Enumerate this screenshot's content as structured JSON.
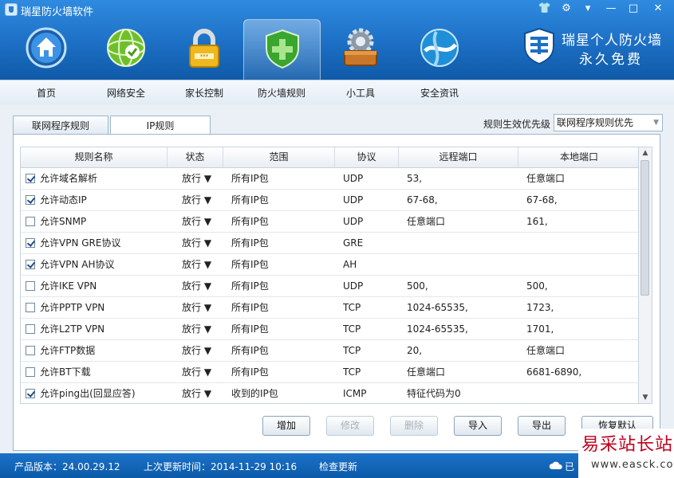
{
  "app": {
    "title": "瑞星防火墙软件"
  },
  "window_controls": {
    "shirt": "👕",
    "gear": "⚙",
    "menu": "▾",
    "minimize": "—",
    "maximize": "□",
    "close": "✕"
  },
  "nav": [
    {
      "label": "首页",
      "icon": "home-icon"
    },
    {
      "label": "网络安全",
      "icon": "globe-check-icon"
    },
    {
      "label": "家长控制",
      "icon": "padlock-icon"
    },
    {
      "label": "防火墙规则",
      "icon": "shield-icon",
      "active": true
    },
    {
      "label": "小工具",
      "icon": "toolbox-gear-icon"
    },
    {
      "label": "安全资讯",
      "icon": "globe-info-icon"
    }
  ],
  "brand": {
    "line1": "瑞星个人防火墙",
    "line2": "永久免费"
  },
  "tabs": [
    {
      "label": "联网程序规则"
    },
    {
      "label": "IP规则",
      "active": true
    }
  ],
  "priority": {
    "label": "规则生效优先级",
    "value": "联网程序规则优先"
  },
  "table": {
    "headers": [
      "规则名称",
      "状态",
      "范围",
      "协议",
      "远程端口",
      "本地端口"
    ],
    "rows": [
      {
        "checked": true,
        "name": "允许域名解析",
        "status": "放行 ▼",
        "scope": "所有IP包",
        "proto": "UDP",
        "remote": "53,",
        "local": "任意端口"
      },
      {
        "checked": true,
        "name": "允许动态IP",
        "status": "放行 ▼",
        "scope": "所有IP包",
        "proto": "UDP",
        "remote": "67-68,",
        "local": "67-68,"
      },
      {
        "checked": false,
        "name": "允许SNMP",
        "status": "放行 ▼",
        "scope": "所有IP包",
        "proto": "UDP",
        "remote": "任意端口",
        "local": "161,"
      },
      {
        "checked": true,
        "name": "允许VPN GRE协议",
        "status": "放行 ▼",
        "scope": "所有IP包",
        "proto": "GRE",
        "remote": "",
        "local": ""
      },
      {
        "checked": true,
        "name": "允许VPN AH协议",
        "status": "放行 ▼",
        "scope": "所有IP包",
        "proto": "AH",
        "remote": "",
        "local": ""
      },
      {
        "checked": false,
        "name": "允许IKE VPN",
        "status": "放行 ▼",
        "scope": "所有IP包",
        "proto": "UDP",
        "remote": "500,",
        "local": "500,"
      },
      {
        "checked": false,
        "name": "允许PPTP VPN",
        "status": "放行 ▼",
        "scope": "所有IP包",
        "proto": "TCP",
        "remote": "1024-65535,",
        "local": "1723,"
      },
      {
        "checked": false,
        "name": "允许L2TP VPN",
        "status": "放行 ▼",
        "scope": "所有IP包",
        "proto": "TCP",
        "remote": "1024-65535,",
        "local": "1701,"
      },
      {
        "checked": false,
        "name": "允许FTP数据",
        "status": "放行 ▼",
        "scope": "所有IP包",
        "proto": "TCP",
        "remote": "20,",
        "local": "任意端口"
      },
      {
        "checked": false,
        "name": "允许BT下载",
        "status": "放行 ▼",
        "scope": "所有IP包",
        "proto": "TCP",
        "remote": "任意端口",
        "local": "6681-6890,"
      },
      {
        "checked": true,
        "name": "允许ping出(回显应答)",
        "status": "放行 ▼",
        "scope": "收到的IP包",
        "proto": "ICMP",
        "remote": "特征代码为0",
        "local": ""
      }
    ]
  },
  "buttons": {
    "add": "增加",
    "edit": "修改",
    "delete": "删除",
    "import": "导入",
    "export": "导出",
    "restore": "恢复默认"
  },
  "status": {
    "version": "产品版本：24.00.29.12",
    "last_update": "上次更新时间：2014-11-29 10:16",
    "check_update": "检查更新",
    "cloud": "已"
  },
  "watermark": {
    "line1": "易采站长站",
    "line2": "www.easck.com"
  },
  "colors": {
    "header_blue": "#1c6fc4",
    "status_blue": "#0c5aa9",
    "watermark_red": "#c0001e"
  }
}
